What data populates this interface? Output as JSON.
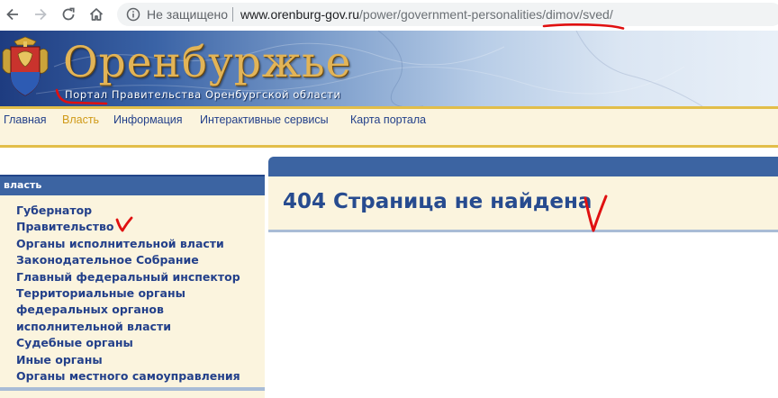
{
  "browser": {
    "security_label": "Не защищено",
    "url_host": "www.orenburg-gov.ru",
    "url_path": "/power/government-personalities/dimov/sved/"
  },
  "header": {
    "title": "Оренбуржье",
    "subtitle": "Портал Правительства Оренбургской области"
  },
  "topnav": {
    "items": [
      {
        "label": "Главная",
        "active": false
      },
      {
        "label": "Власть",
        "active": true
      },
      {
        "label": "Информация",
        "active": false
      },
      {
        "label": "Интерактивные сервисы",
        "active": false
      },
      {
        "label": "Карта портала",
        "active": false
      }
    ]
  },
  "sidebar": {
    "heading": "власть",
    "items": [
      "Губернатор",
      "Правительство",
      "Органы исполнительной власти",
      "Законодательное Собрание",
      "Главный федеральный инспектор",
      "Территориальные органы федеральных органов исполнительной власти",
      "Судебные органы",
      "Иные органы",
      "Органы местного самоуправления"
    ]
  },
  "main": {
    "error_title": "404 Страница не найдена"
  },
  "colors": {
    "nav_blue": "#3c64a2",
    "link_blue": "#23408a",
    "active_gold": "#d09a18",
    "panel_cream": "#fbf4de",
    "annotation_red": "#e01010"
  }
}
